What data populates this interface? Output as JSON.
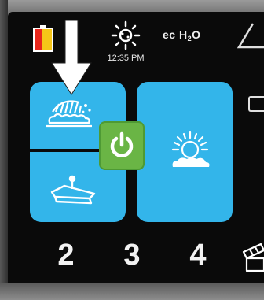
{
  "status_bar": {
    "clock": "12:35 PM",
    "ec_label": "ec",
    "h2o_label": "H",
    "h2o_sub": "2",
    "h2o_tail": "O",
    "battery_level": 0.55,
    "icons": [
      "battery-icon",
      "sun-settings-icon",
      "warning-icon"
    ]
  },
  "modes": {
    "scrub": {
      "icon": "scrub-brush-icon"
    },
    "squeegee": {
      "icon": "squeegee-icon"
    },
    "burnish": {
      "icon": "sun-cloud-icon"
    },
    "power": {
      "icon": "power-icon"
    }
  },
  "bottom_bar": {
    "numbers": [
      "2",
      "3",
      "4"
    ],
    "icons": [
      "film-icon"
    ]
  },
  "colors": {
    "panel_blue": "#33b5ea",
    "power_green": "#6ab545",
    "screen_black": "#0a0a0a",
    "battery_red": "#e8261c",
    "battery_yellow": "#f5c518",
    "arrow_white": "#ffffff"
  }
}
